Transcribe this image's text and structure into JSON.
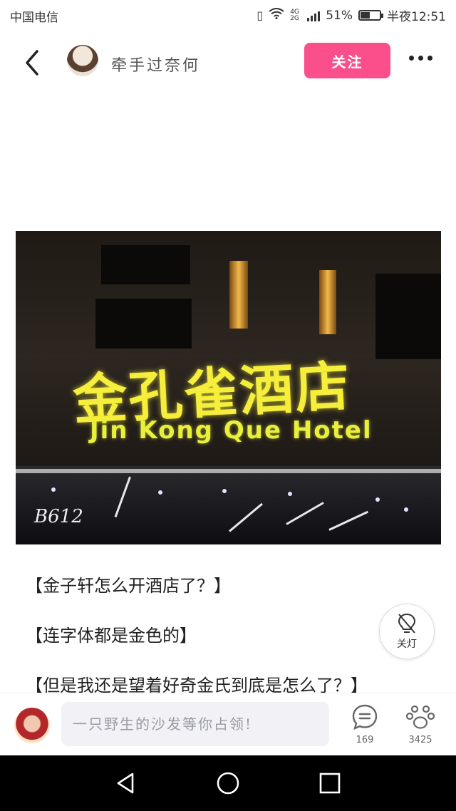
{
  "status_bar": {
    "carrier": "中国电信",
    "network": "4G 2G",
    "battery_percent": "51%",
    "battery_level": 0.51,
    "time": "半夜12:51"
  },
  "header": {
    "author_name": "牵手过奈何",
    "follow_label": "关注"
  },
  "post": {
    "image": {
      "sign_cn": "金孔雀酒店",
      "sign_en": "Jin Kong Que Hotel",
      "watermark": "B612"
    },
    "paragraphs": [
      "【金子轩怎么开酒店了？】",
      "【连字体都是金色的】",
      "【但是我还是望着好奇金氏到底是怎么了？】"
    ],
    "light_button_label": "关灯"
  },
  "bottom_bar": {
    "comment_placeholder": "一只野生的沙发等你占领!",
    "comment_count": "169",
    "like_count": "3425"
  },
  "icons": {
    "back": "back-arrow-icon",
    "more": "more-dots-icon",
    "light": "lightbulb-icon",
    "comments": "comment-icon",
    "likes": "paw-icon"
  },
  "colors": {
    "accent": "#fb4f8b",
    "sign_yellow": "#f5ee3a"
  }
}
